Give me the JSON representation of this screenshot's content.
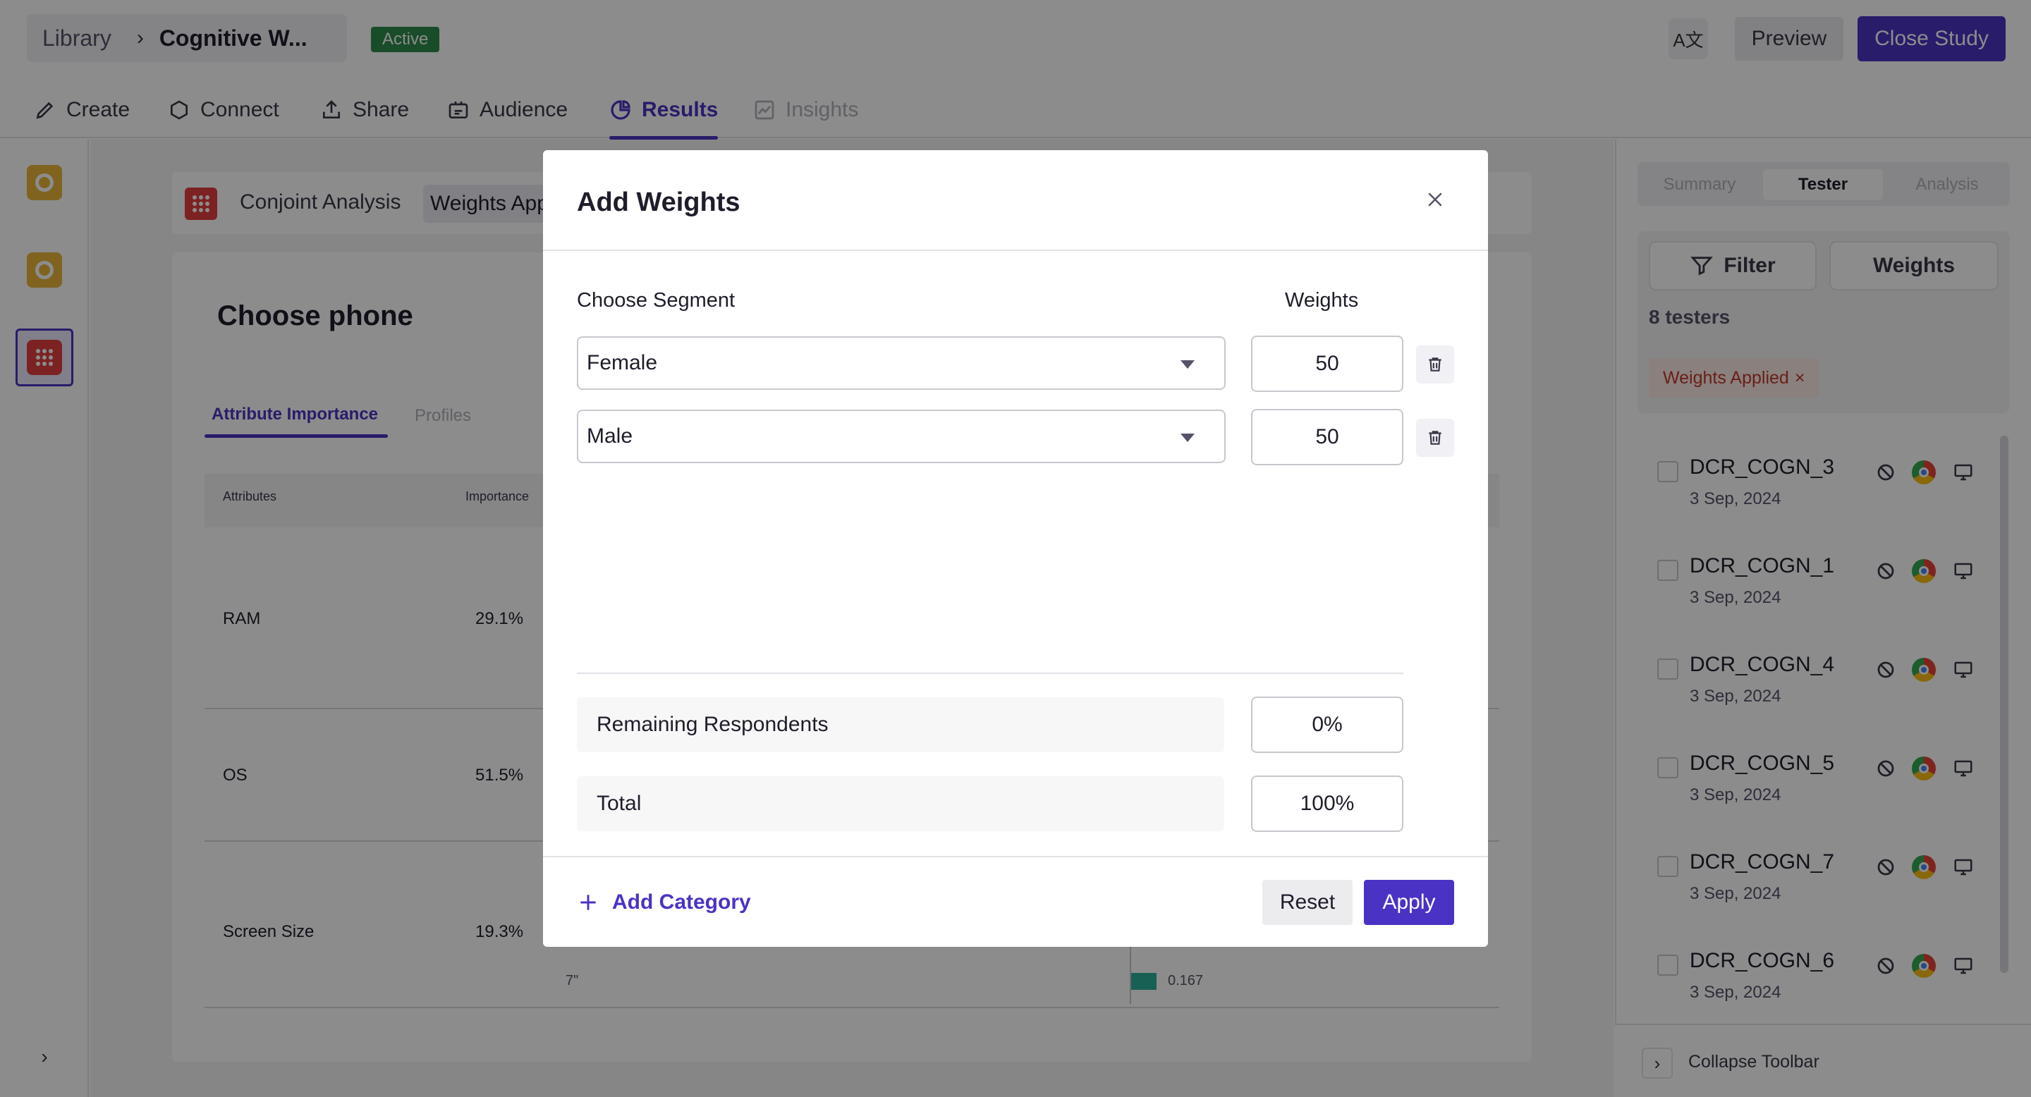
{
  "header": {
    "breadcrumb_library": "Library",
    "breadcrumb_study": "Cognitive W...",
    "status_badge": "Active",
    "translate_glyph": "A文",
    "preview_label": "Preview",
    "close_study_label": "Close Study"
  },
  "nav_tabs": [
    {
      "label": "Create",
      "icon": "pencil-icon"
    },
    {
      "label": "Connect",
      "icon": "hexagon-icon"
    },
    {
      "label": "Share",
      "icon": "share-icon"
    },
    {
      "label": "Audience",
      "icon": "audience-icon"
    },
    {
      "label": "Results",
      "icon": "pie-chart-icon",
      "active": true
    },
    {
      "label": "Insights",
      "icon": "insights-icon",
      "disabled": true
    }
  ],
  "content": {
    "section_label": "Conjoint Analysis",
    "weights_applied_label": "Weights Applied",
    "question_title": "Choose phone",
    "sub_tabs": [
      "Attribute Importance",
      "Profiles"
    ],
    "table_headers": [
      "Attributes",
      "Importance"
    ],
    "rows": [
      {
        "attribute": "RAM",
        "importance": "29.1%"
      },
      {
        "attribute": "OS",
        "importance": "51.5%"
      },
      {
        "attribute": "Screen Size",
        "importance": "19.3%"
      }
    ],
    "level_label": "7\"",
    "level_value": "0.167"
  },
  "right_panel": {
    "tabs": [
      "Summary",
      "Tester",
      "Analysis"
    ],
    "active_tab": "Tester",
    "filter_label": "Filter",
    "weights_label": "Weights",
    "tester_count": "8 testers",
    "weights_chip": "Weights Applied",
    "testers": [
      {
        "name": "DCR_COGN_3",
        "date": "3 Sep, 2024"
      },
      {
        "name": "DCR_COGN_1",
        "date": "3 Sep, 2024"
      },
      {
        "name": "DCR_COGN_4",
        "date": "3 Sep, 2024"
      },
      {
        "name": "DCR_COGN_5",
        "date": "3 Sep, 2024"
      },
      {
        "name": "DCR_COGN_7",
        "date": "3 Sep, 2024"
      },
      {
        "name": "DCR_COGN_6",
        "date": "3 Sep, 2024"
      }
    ],
    "collapse_label": "Collapse Toolbar"
  },
  "modal": {
    "title": "Add Weights",
    "col_segment": "Choose Segment",
    "col_weights": "Weights",
    "segments": [
      {
        "segment": "Female",
        "weight": "50"
      },
      {
        "segment": "Male",
        "weight": "50"
      }
    ],
    "remaining_label": "Remaining Respondents",
    "remaining_value": "0%",
    "total_label": "Total",
    "total_value": "100%",
    "add_category_label": "Add Category",
    "reset_label": "Reset",
    "apply_label": "Apply"
  },
  "colors": {
    "accent": "#4a33c4",
    "active_badge": "#2f8a4a",
    "chip_text": "#c0392b",
    "bar": "#2eb09a"
  }
}
